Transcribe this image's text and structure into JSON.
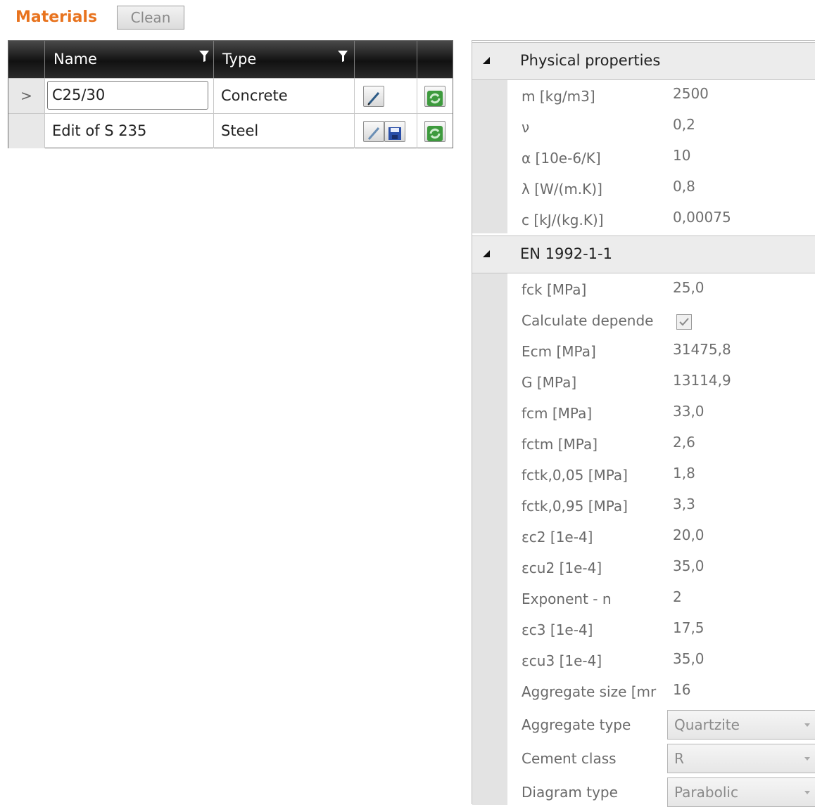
{
  "header": {
    "title": "Materials",
    "clean_label": "Clean"
  },
  "grid": {
    "columns": [
      {
        "label": "Name"
      },
      {
        "label": "Type"
      }
    ],
    "rows": [
      {
        "indicator": ">",
        "name": "C25/30",
        "type": "Concrete"
      },
      {
        "indicator": "",
        "name": "Edit of S 235",
        "type": "Steel"
      }
    ]
  },
  "properties": {
    "physical": {
      "title": "Physical properties",
      "items": [
        {
          "label": "m [kg/m3]",
          "value": "2500"
        },
        {
          "label": "ν",
          "value": "0,2"
        },
        {
          "label": "α [10e-6/K]",
          "value": "10"
        },
        {
          "label": "λ [W/(m.K)]",
          "value": "0,8"
        },
        {
          "label": "c [kJ/(kg.K)]",
          "value": "0,00075"
        }
      ]
    },
    "en": {
      "title": "EN 1992-1-1",
      "items": [
        {
          "label": "fck [MPa]",
          "value": "25,0"
        },
        {
          "label": "Calculate depende",
          "checked": true
        },
        {
          "label": "Ecm [MPa]",
          "value": "31475,8"
        },
        {
          "label": "G [MPa]",
          "value": "13114,9"
        },
        {
          "label": "fcm [MPa]",
          "value": "33,0"
        },
        {
          "label": "fctm [MPa]",
          "value": "2,6"
        },
        {
          "label": "fctk,0,05 [MPa]",
          "value": "1,8"
        },
        {
          "label": "fctk,0,95 [MPa]",
          "value": "3,3"
        },
        {
          "label": "εc2 [1e-4]",
          "value": "20,0"
        },
        {
          "label": "εcu2 [1e-4]",
          "value": "35,0"
        },
        {
          "label": "Exponent - n",
          "value": "2"
        },
        {
          "label": "εc3 [1e-4]",
          "value": "17,5"
        },
        {
          "label": "εcu3 [1e-4]",
          "value": "35,0"
        },
        {
          "label": "Aggregate size [mr",
          "value": "16"
        },
        {
          "label": "Aggregate type",
          "select": "Quartzite"
        },
        {
          "label": "Cement class",
          "select": "R"
        },
        {
          "label": "Diagram type",
          "select": "Parabolic"
        }
      ]
    }
  },
  "colors": {
    "accent": "#e8731e",
    "header_bg": "#1a1a1a"
  }
}
